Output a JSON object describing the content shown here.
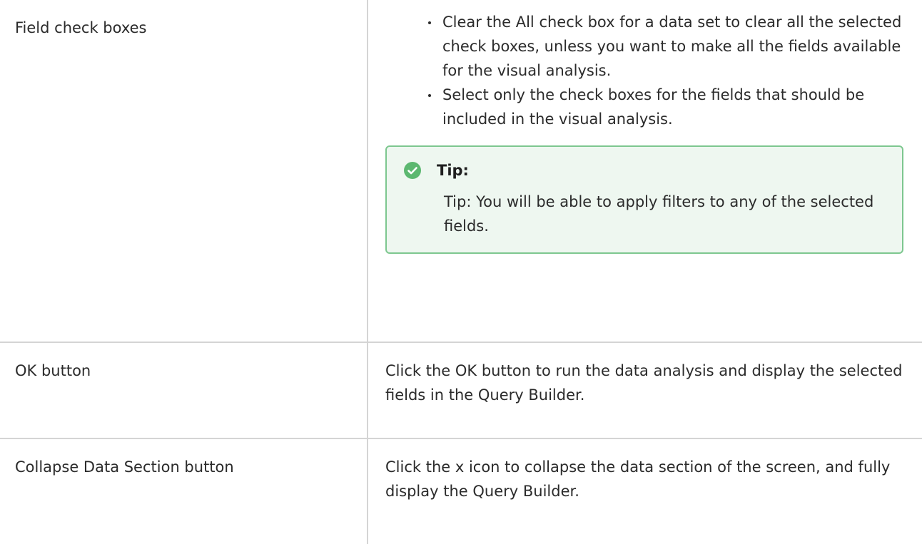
{
  "rows": [
    {
      "label": "Field check boxes",
      "bullets": [
        "Clear the All check box for a data set to clear all the selected check boxes, unless you want to make all the fields available for the visual analysis.",
        "Select only the check boxes for the fields that should be included in the visual analysis."
      ],
      "tip": {
        "title": "Tip:",
        "body": "Tip: You will be able to apply filters to any of the selected fields.",
        "icon": "check-circle-icon",
        "border_color": "#7dc78f",
        "background_color": "#eef7f0",
        "icon_color": "#5cb870"
      }
    },
    {
      "label": "OK button",
      "description": "Click the OK button to run the data analysis and display the selected fields in the Query Builder."
    },
    {
      "label": "Collapse Data Section button",
      "description": "Click the x icon to collapse the data section of the screen, and fully display the Query Builder."
    }
  ]
}
